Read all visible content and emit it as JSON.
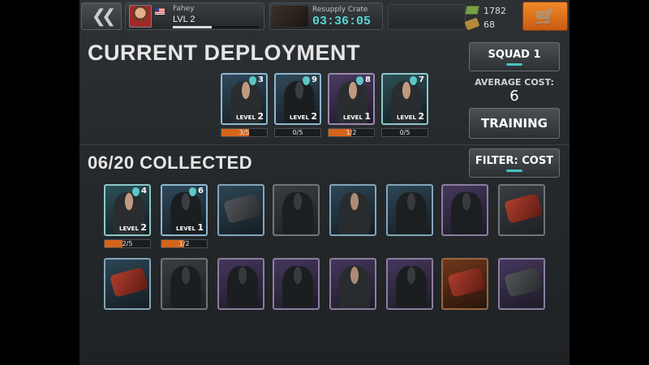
{
  "player": {
    "name": "Fahey",
    "level": "LVL 2",
    "xp_fraction": 0.45
  },
  "crate": {
    "label": "Resupply Crate",
    "timer": "03:36:05"
  },
  "currency": {
    "cash": "1782",
    "parts": "68"
  },
  "deployment": {
    "title": "CURRENT DEPLOYMENT",
    "cards": [
      {
        "cost": "3",
        "level_label": "LEVEL",
        "level": "2",
        "progress": "3/5",
        "progress_fraction": 0.6
      },
      {
        "cost": "9",
        "level_label": "LEVEL",
        "level": "2",
        "progress": "0/5",
        "progress_fraction": 0
      },
      {
        "cost": "8",
        "level_label": "LEVEL",
        "level": "1",
        "progress": "1/2",
        "progress_fraction": 0.5
      },
      {
        "cost": "7",
        "level_label": "LEVEL",
        "level": "2",
        "progress": "0/5",
        "progress_fraction": 0
      }
    ]
  },
  "sidebar": {
    "squad_label": "SQUAD 1",
    "avg_cost_label": "AVERAGE COST:",
    "avg_cost_value": "6",
    "training_label": "TRAINING",
    "filter_label": "FILTER: COST"
  },
  "collection": {
    "title": "06/20 COLLECTED",
    "owned": [
      {
        "cost": "4",
        "level_label": "LEVEL",
        "level": "2",
        "progress": "2/5",
        "progress_fraction": 0.4
      },
      {
        "cost": "6",
        "level_label": "LEVEL",
        "level": "1",
        "progress": "1/2",
        "progress_fraction": 0.5
      }
    ]
  },
  "colors": {
    "accent_teal": "#59d6cf",
    "shop_orange": "#f08a2a",
    "progress_orange": "#d4651c"
  },
  "icons": [
    "back-chevrons-icon",
    "flag-icon",
    "cart-icon",
    "cash-icon",
    "parts-icon",
    "cost-drop-icon"
  ]
}
